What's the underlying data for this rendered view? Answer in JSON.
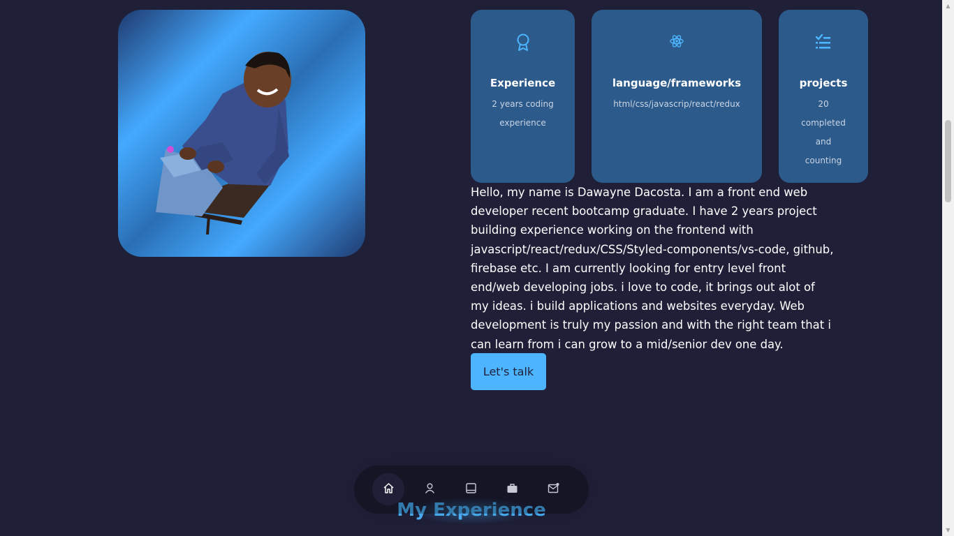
{
  "cards": [
    {
      "icon": "award-icon",
      "title": "Experience",
      "text": "2 years coding experience"
    },
    {
      "icon": "react-icon",
      "title": "language/frameworks",
      "text": "html/css/javascrip/react/redux"
    },
    {
      "icon": "checklist-icon",
      "title": "projects",
      "text": "20 completed and counting"
    }
  ],
  "bio": "Hello, my name is Dawayne Dacosta. I am a front end web developer recent bootcamp graduate. I have 2 years project building experience working on the frontend with javascript/react/redux/CSS/Styled-components/vs-code, github, firebase etc. I am currently looking for entry level front end/web developing jobs. i love to code, it brings out alot of my ideas. i build applications and websites everyday. Web development is truly my passion and with the right team that i can learn from i can grow to a mid/senior dev one day.",
  "cta_label": "Let's talk",
  "next_section_title": "My Experience",
  "nav": [
    {
      "icon": "home-icon",
      "active": true
    },
    {
      "icon": "user-icon",
      "active": false
    },
    {
      "icon": "book-icon",
      "active": false
    },
    {
      "icon": "briefcase-icon",
      "active": false
    },
    {
      "icon": "mail-icon",
      "active": false
    }
  ],
  "colors": {
    "background": "#1f1f38",
    "accent": "#4db5ff",
    "card": "#2c5a8a"
  }
}
